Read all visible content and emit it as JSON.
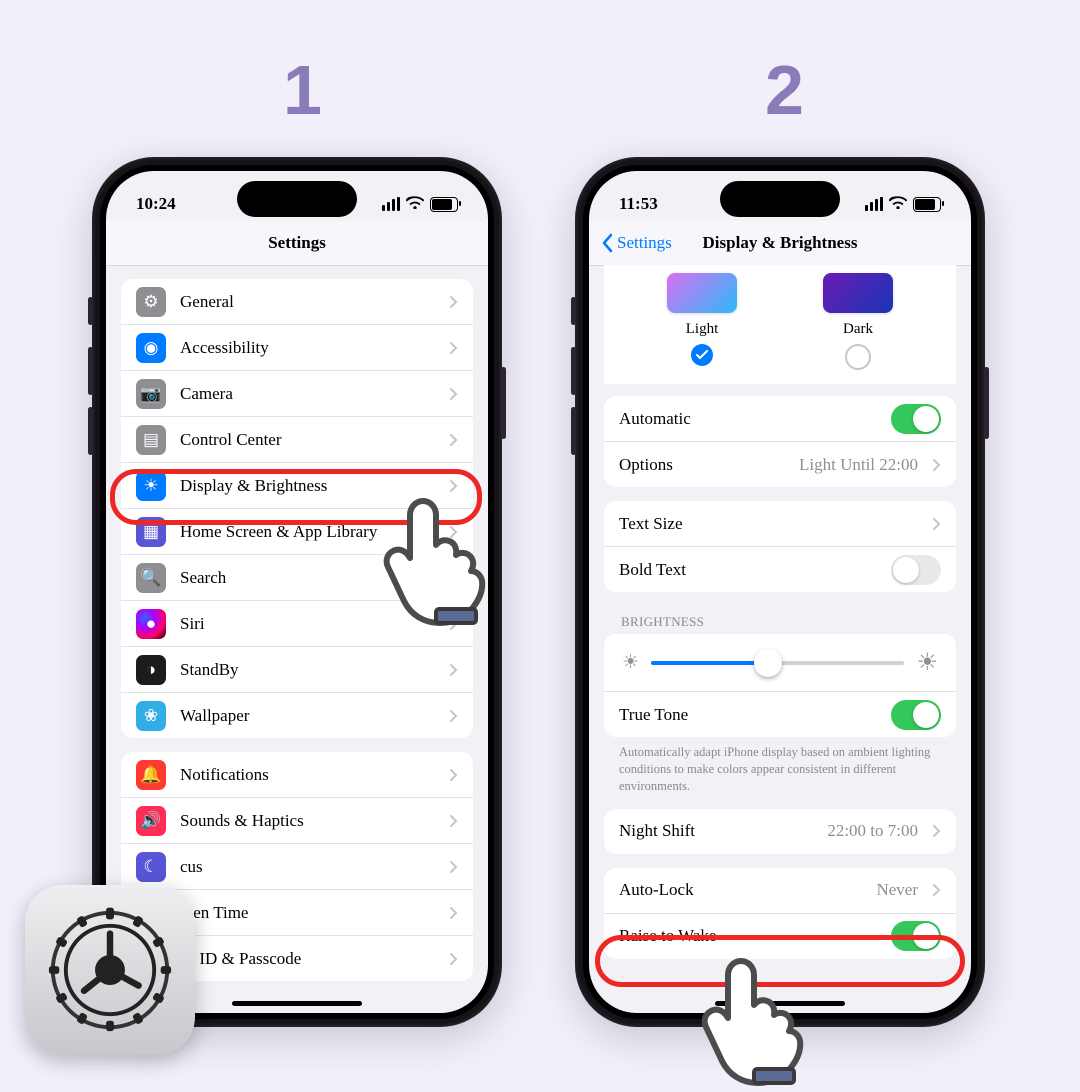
{
  "steps": {
    "one": "1",
    "two": "2"
  },
  "phone1": {
    "time": "10:24",
    "title": "Settings",
    "rows": [
      {
        "label": "General",
        "icon": "gear",
        "bg": "ic-gray"
      },
      {
        "label": "Accessibility",
        "icon": "accessibility",
        "bg": "ic-blue"
      },
      {
        "label": "Camera",
        "icon": "camera",
        "bg": "ic-gray"
      },
      {
        "label": "Control Center",
        "icon": "switches",
        "bg": "ic-gray"
      },
      {
        "label": "Display & Brightness",
        "icon": "sun",
        "bg": "ic-blue"
      },
      {
        "label": "Home Screen & App Library",
        "icon": "grid",
        "bg": "ic-indigo"
      },
      {
        "label": "Search",
        "icon": "search",
        "bg": "ic-gray"
      },
      {
        "label": "Siri",
        "icon": "siri",
        "bg": "ic-siri"
      },
      {
        "label": "StandBy",
        "icon": "clock",
        "bg": "ic-blk"
      },
      {
        "label": "Wallpaper",
        "icon": "flower",
        "bg": "ic-cyan"
      }
    ],
    "rows2": [
      {
        "label": "Notifications",
        "icon": "bell",
        "bg": "ic-red"
      },
      {
        "label": "Sounds & Haptics",
        "icon": "speaker",
        "bg": "ic-pink"
      },
      {
        "label": "Focus",
        "icon": "moon",
        "bg": "ic-indigo",
        "partial": "cus"
      },
      {
        "label": "Screen Time",
        "icon": "hourglass",
        "bg": "ic-indigo",
        "partial": "reen Time"
      },
      {
        "label": "Face ID & Passcode",
        "icon": "faceid",
        "bg": "ic-grn",
        "partial": "ce ID & Passcode"
      }
    ]
  },
  "phone2": {
    "time": "11:53",
    "back": "Settings",
    "title": "Display & Brightness",
    "appearance": {
      "light": "Light",
      "dark": "Dark"
    },
    "automatic": "Automatic",
    "options": "Options",
    "options_val": "Light Until 22:00",
    "textsize": "Text Size",
    "bold": "Bold Text",
    "brightness_h": "BRIGHTNESS",
    "truetone": "True Tone",
    "truetone_foot": "Automatically adapt iPhone display based on ambient lighting conditions to make colors appear consistent in different environments.",
    "nightshift": "Night Shift",
    "nightshift_val": "22:00 to 7:00",
    "autolock": "Auto-Lock",
    "autolock_val": "Never",
    "raise": "Raise to Wake"
  }
}
